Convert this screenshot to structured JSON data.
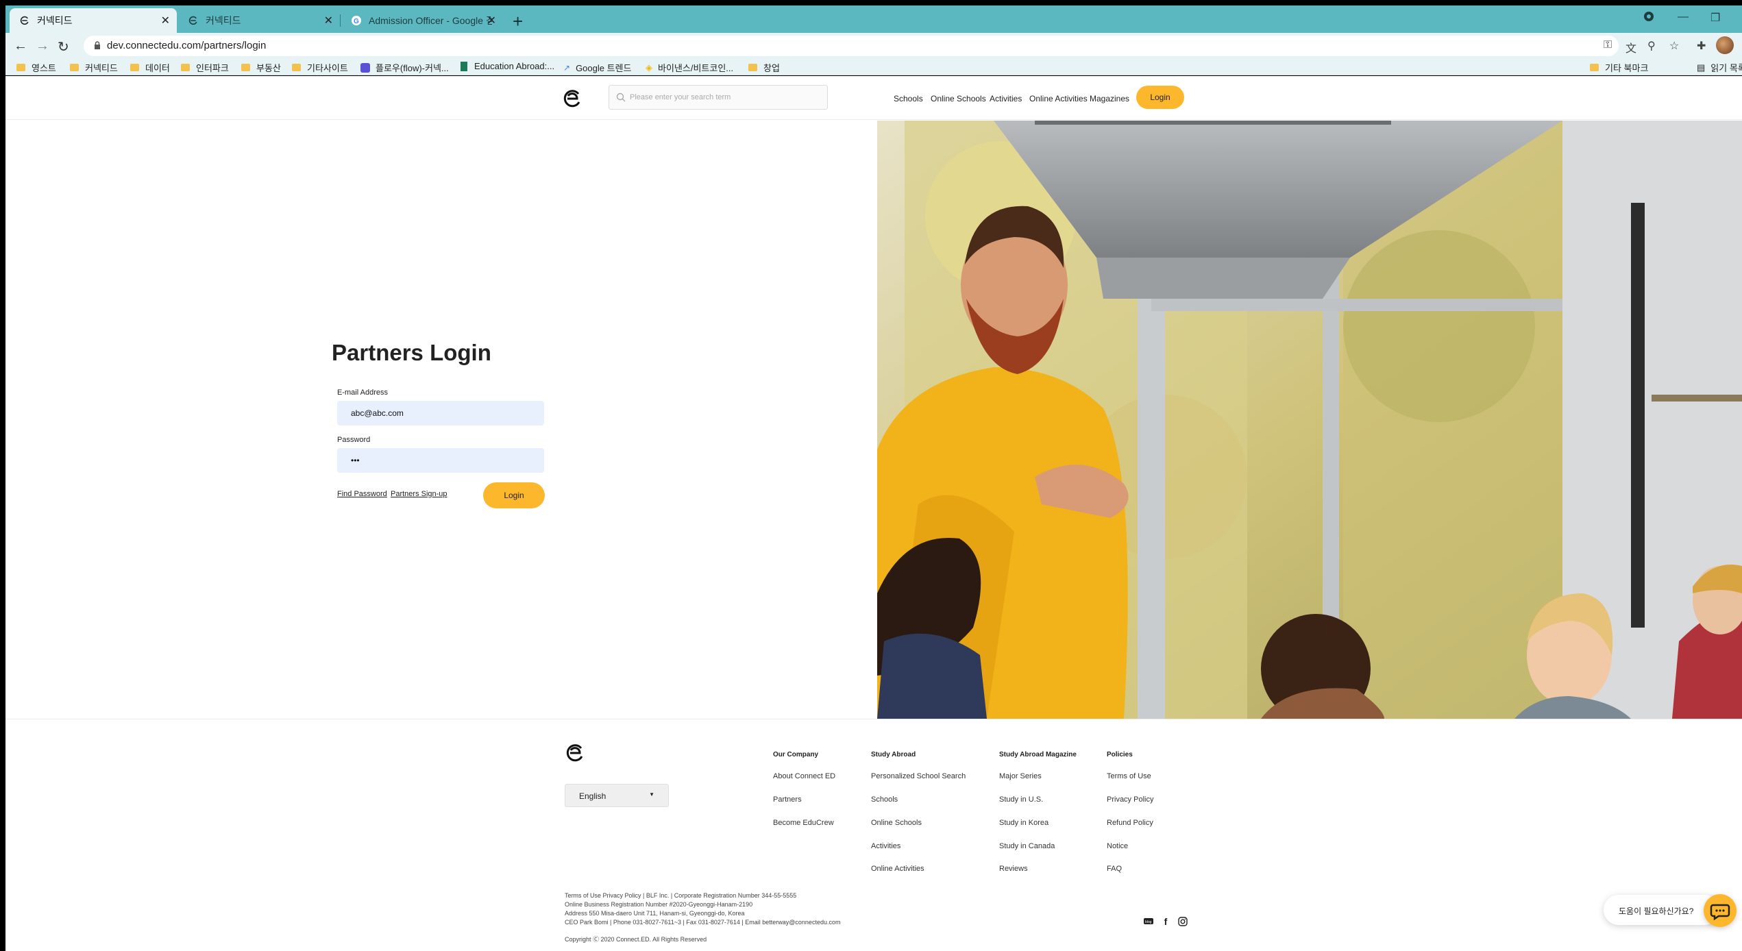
{
  "browser": {
    "tabs": [
      {
        "title": "커넥티드",
        "active": true
      },
      {
        "title": "커넥티드",
        "active": false
      },
      {
        "title": "Admission Officer - Google 검색",
        "active": false
      }
    ],
    "url": "dev.connectedu.com/partners/login",
    "bookmarks": [
      "영스트",
      "커넥티드",
      "데이터",
      "인터파크",
      "부동산",
      "기타사이트",
      "플로우(flow)-커넥...",
      "Education Abroad:...",
      "Google 트렌드",
      "바이낸스/비트코인...",
      "창업"
    ],
    "bookmarks_right": [
      "기타 북마크",
      "읽기 목록"
    ]
  },
  "header": {
    "search_placeholder": "Please enter your search term",
    "nav": [
      "Schools",
      "Online Schools",
      "Activities",
      "Online Activities",
      "Magazines"
    ],
    "login_label": "Login"
  },
  "login": {
    "title": "Partners Login",
    "email_label": "E-mail Address",
    "email_value": "abc@abc.com",
    "password_label": "Password",
    "password_value": "•••",
    "find_password": "Find Password",
    "signup": "Partners Sign-up",
    "button": "Login"
  },
  "footer": {
    "language": "English",
    "columns": [
      {
        "title": "Our Company",
        "links": [
          "About Connect ED",
          "Partners",
          "Become EduCrew"
        ]
      },
      {
        "title": "Study Abroad",
        "links": [
          "Personalized School Search",
          "Schools",
          "Online Schools",
          "Activities",
          "Online Activities"
        ]
      },
      {
        "title": "Study Abroad Magazine",
        "links": [
          "Major Series",
          "Study in U.S.",
          "Study in Korea",
          "Study in Canada",
          "Reviews"
        ]
      },
      {
        "title": "Policies",
        "links": [
          "Terms of Use",
          "Privacy Policy",
          "Refund Policy",
          "Notice",
          "FAQ"
        ]
      }
    ],
    "legal": [
      "Terms of Use Privacy Policy | BLF Inc. | Corporate Registration Number 344-55-5555",
      "Online Business Registration Number #2020-Gyeonggi-Hanam-2190",
      "Address 550 Misa-daero Unit 711, Hanam-si, Gyeonggi-do, Korea",
      "CEO Park Bomi | Phone 031-8027-7611~3 | Fax 031-8027-7614 | Email betterway@connectedu.com"
    ],
    "copyright": "Copyright Ⓒ 2020 Connect.ED. All Rights Reserved",
    "help_text": "도움이 필요하신가요?"
  },
  "colors": {
    "accent": "#fdb72d",
    "chrome": "#5cb8c0",
    "input_bg": "#e8f0fe"
  }
}
